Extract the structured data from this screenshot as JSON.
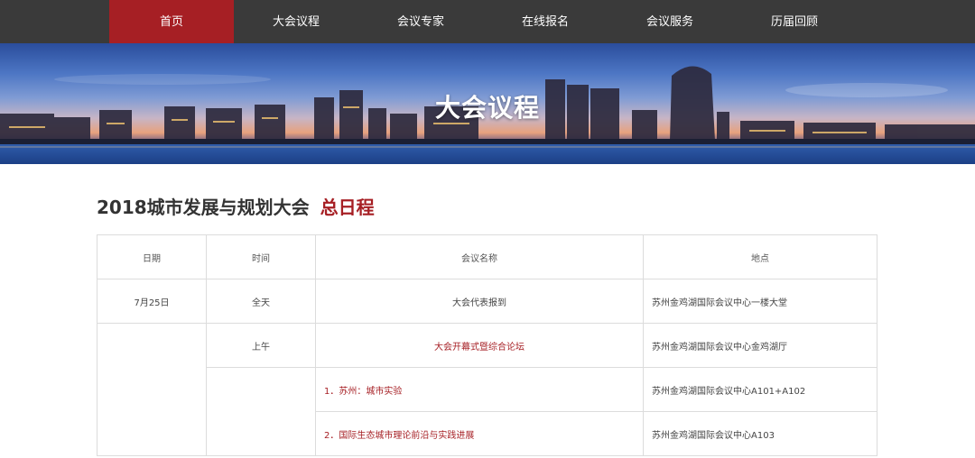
{
  "nav": {
    "items": [
      {
        "label": "首页",
        "active": true
      },
      {
        "label": "大会议程",
        "active": false
      },
      {
        "label": "会议专家",
        "active": false
      },
      {
        "label": "在线报名",
        "active": false
      },
      {
        "label": "会议服务",
        "active": false
      },
      {
        "label": "历届回顾",
        "active": false
      }
    ]
  },
  "banner": {
    "title": "大会议程"
  },
  "heading": {
    "title": "2018城市发展与规划大会",
    "accent": "总日程"
  },
  "table": {
    "headers": [
      "日期",
      "时间",
      "会议名称",
      "地点"
    ],
    "rows": [
      {
        "date": "7月25日",
        "time": "全天",
        "name": "大会代表报到",
        "location": "苏州金鸡湖国际会议中心一楼大堂"
      },
      {
        "date": "",
        "time": "上午",
        "name": "大会开幕式暨综合论坛",
        "location": "苏州金鸡湖国际会议中心金鸡湖厅"
      },
      {
        "date": "",
        "time": "",
        "name": "1．苏州：城市实验",
        "location": "苏州金鸡湖国际会议中心A101+A102"
      },
      {
        "date": "",
        "time": "",
        "name": "2．国际生态城市理论前沿与实践进展",
        "location": "苏州金鸡湖国际会议中心A103"
      }
    ]
  },
  "colors": {
    "nav_bg": "#3a3a3a",
    "accent": "#a61f24"
  }
}
